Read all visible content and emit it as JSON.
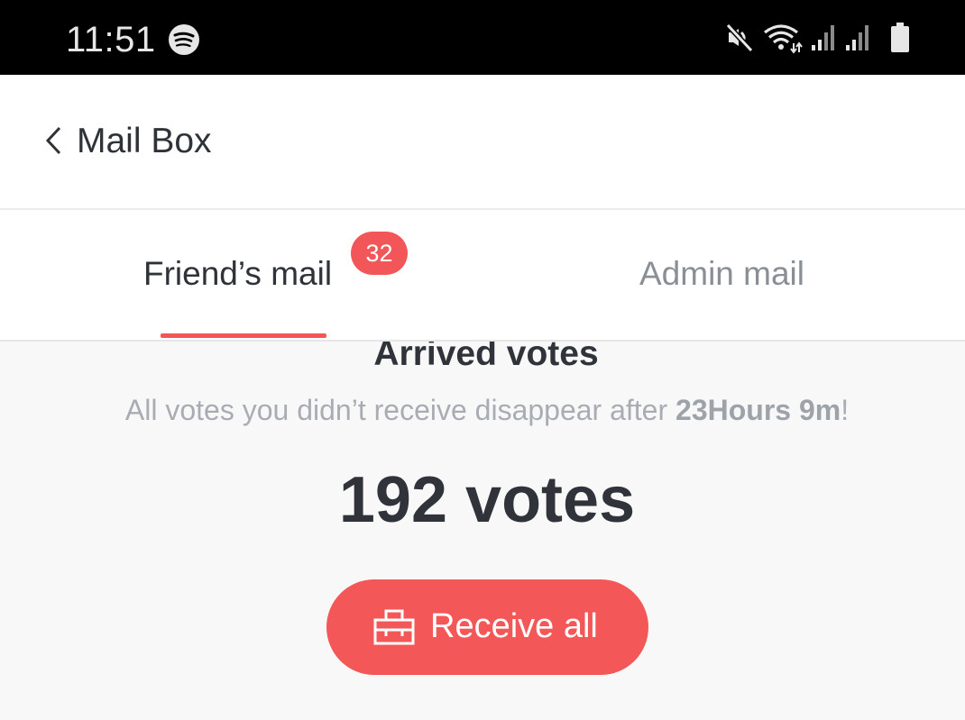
{
  "status_bar": {
    "time": "11:51",
    "icons": [
      "spotify-icon",
      "mute-icon",
      "wifi-icon",
      "signal-icon",
      "signal-icon",
      "battery-icon"
    ]
  },
  "header": {
    "title": "Mail Box",
    "back_icon": "chevron-left-icon"
  },
  "tabs": [
    {
      "label": "Friend’s mail",
      "badge": "32",
      "active": true
    },
    {
      "label": "Admin mail",
      "active": false
    }
  ],
  "content": {
    "heading": "Arrived votes",
    "notice_prefix": "All votes you didn’t receive disappear after ",
    "notice_time": "23Hours 9m",
    "notice_suffix": "!",
    "votes": "192 votes",
    "receive_button": "Receive all"
  },
  "colors": {
    "accent": "#f25658",
    "text_dark": "#2f3338",
    "text_muted": "#a9adb3"
  }
}
